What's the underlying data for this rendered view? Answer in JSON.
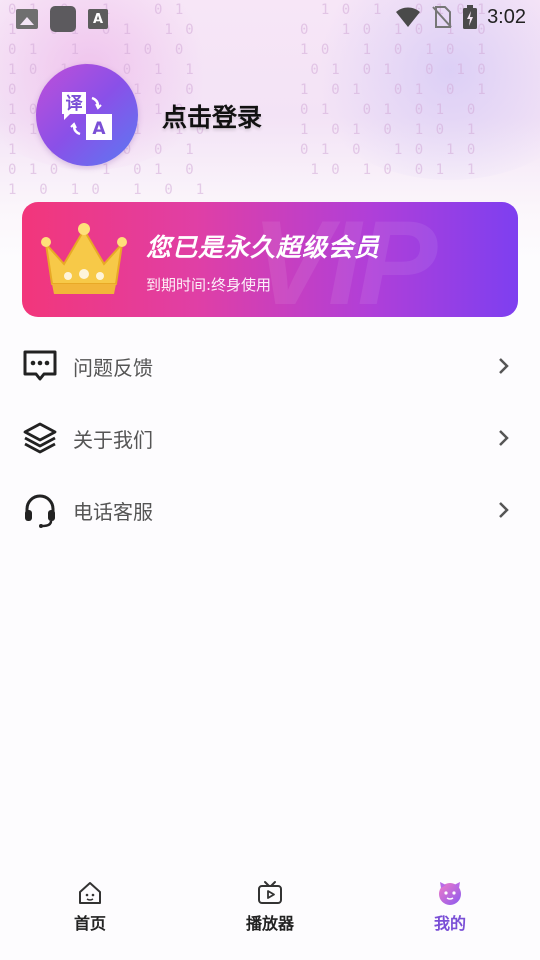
{
  "status_bar": {
    "time": "3:02",
    "left_icons": [
      "gallery-icon",
      "app-square-icon",
      "font-a-icon"
    ],
    "right_icons": [
      "wifi-icon",
      "no-sim-icon",
      "battery-charging-icon"
    ]
  },
  "header": {
    "login_text": "点击登录",
    "avatar_icon": "translate-app-logo"
  },
  "vip_card": {
    "title": "您已是永久超级会员",
    "expire_text": "到期时间:终身使用",
    "watermark": "VIP",
    "icon": "crown-icon"
  },
  "menu": {
    "items": [
      {
        "label": "问题反馈",
        "icon": "feedback-chat-icon"
      },
      {
        "label": "关于我们",
        "icon": "layers-icon"
      },
      {
        "label": "电话客服",
        "icon": "headset-icon"
      }
    ]
  },
  "bottom_nav": {
    "items": [
      {
        "label": "首页",
        "icon": "home-icon",
        "active": false
      },
      {
        "label": "播放器",
        "icon": "tv-play-icon",
        "active": false
      },
      {
        "label": "我的",
        "icon": "profile-face-icon",
        "active": true
      }
    ],
    "active_color": "#7a4fd6"
  },
  "colors": {
    "vip_gradient_start": "#f2367b",
    "vip_gradient_end": "#7e3ff0",
    "crown_gold": "#f7c948"
  }
}
